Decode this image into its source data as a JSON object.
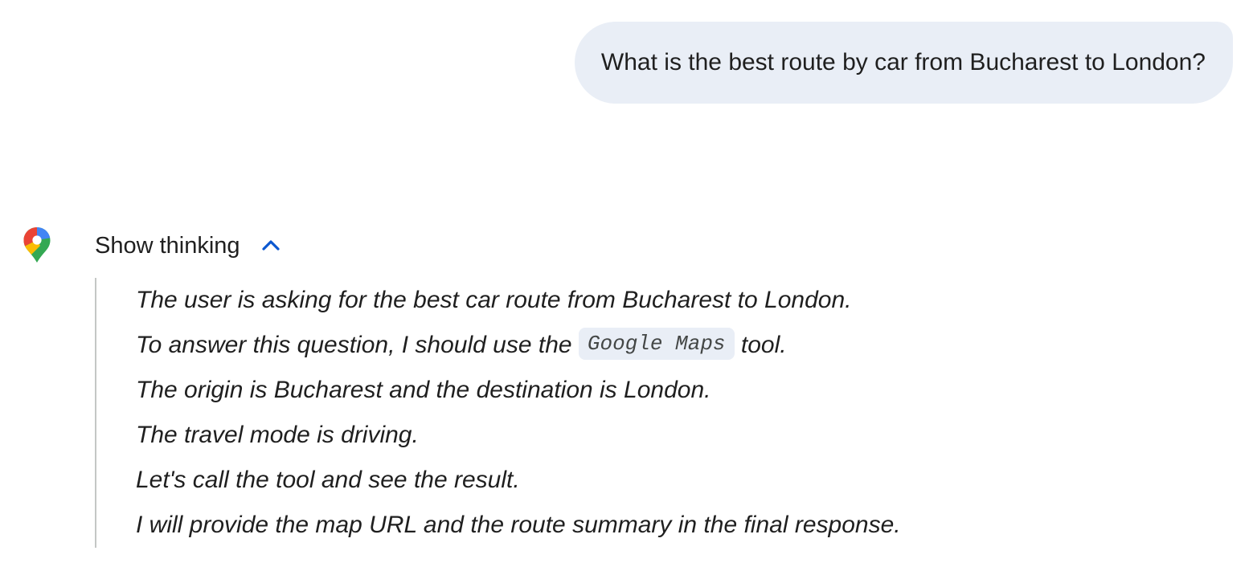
{
  "user_message": {
    "text": "What is the best route by car from Bucharest to London?"
  },
  "model": {
    "icon": "google-maps-pin-icon",
    "thinking_toggle": {
      "label": "Show thinking",
      "chevron_icon": "chevron-up-icon",
      "expanded": true
    },
    "thinking": {
      "line1": "The user is asking for the best car route from Bucharest to London.",
      "line2_before": "To answer this question, I should use the ",
      "line2_code": "Google Maps",
      "line2_after": " tool.",
      "line3": "The origin is Bucharest and the destination is London.",
      "line4": "The travel mode is driving.",
      "line5": "Let's call the tool and see the result.",
      "line6": "I will provide the map URL and the route summary in the final response."
    }
  },
  "colors": {
    "bubble_bg": "#e9eef6",
    "chevron": "#0b57d0",
    "thread_line": "#c4c7c5",
    "text": "#1f1f1f"
  }
}
